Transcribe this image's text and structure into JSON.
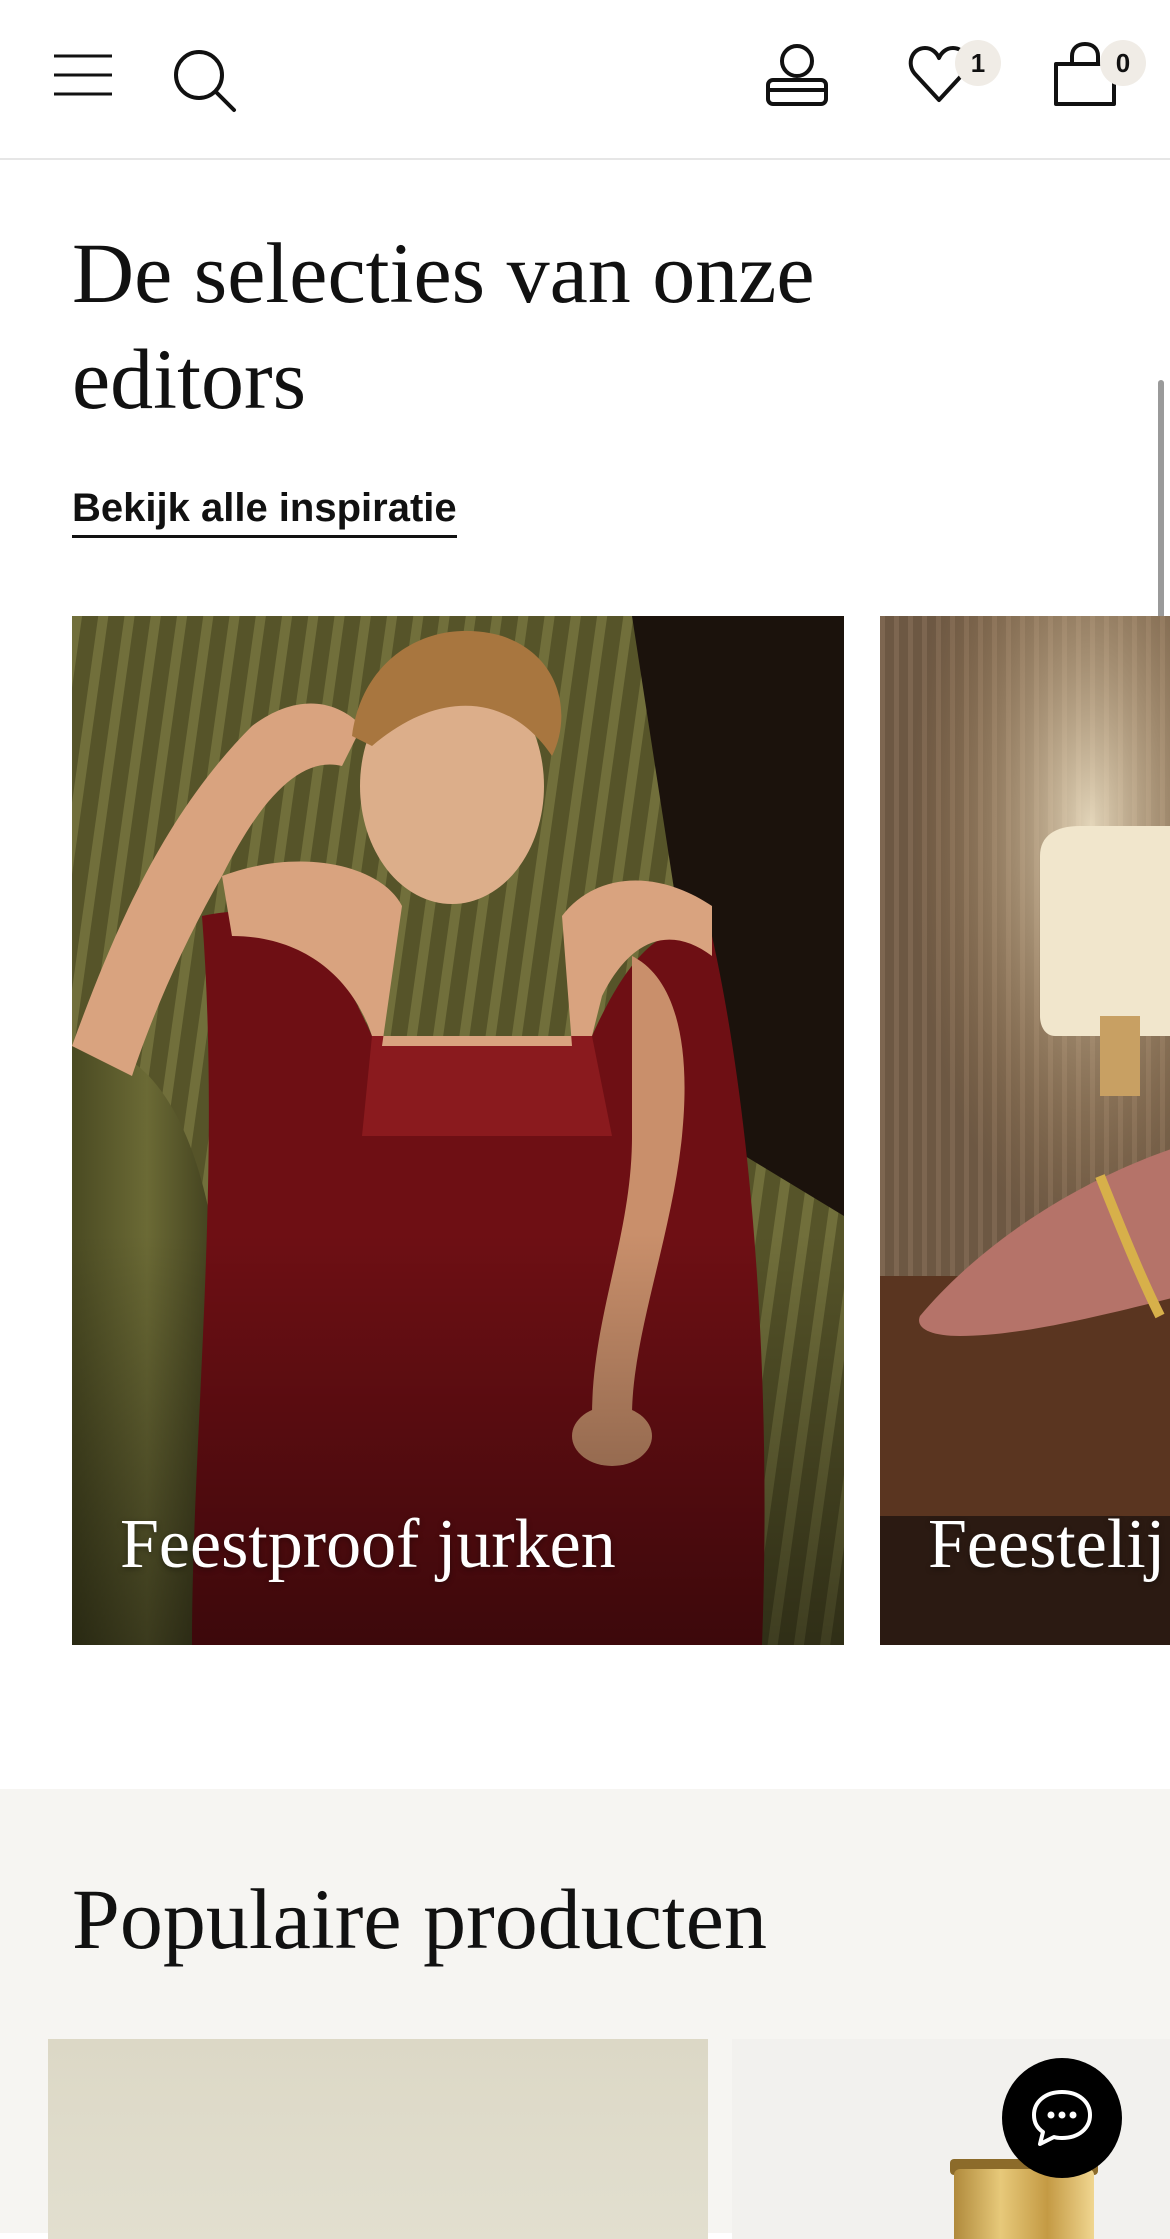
{
  "header": {
    "icons": [
      "menu-icon",
      "search-icon",
      "account-icon",
      "wishlist-icon",
      "bag-icon"
    ],
    "wishlist_count": "1",
    "bag_count": "0"
  },
  "editors": {
    "title": "De selecties van onze editors",
    "link_label": "Bekijk alle inspiratie",
    "cards": [
      {
        "caption": "Feestproof jurken"
      },
      {
        "caption": "Feestelij"
      }
    ]
  },
  "popular": {
    "title": "Populaire producten"
  },
  "chat": {
    "icon": "chat-bubble-icon"
  },
  "colors": {
    "text": "#111111",
    "section_bg": "#f6f5f2",
    "badge_bg": "#f0ece6"
  }
}
